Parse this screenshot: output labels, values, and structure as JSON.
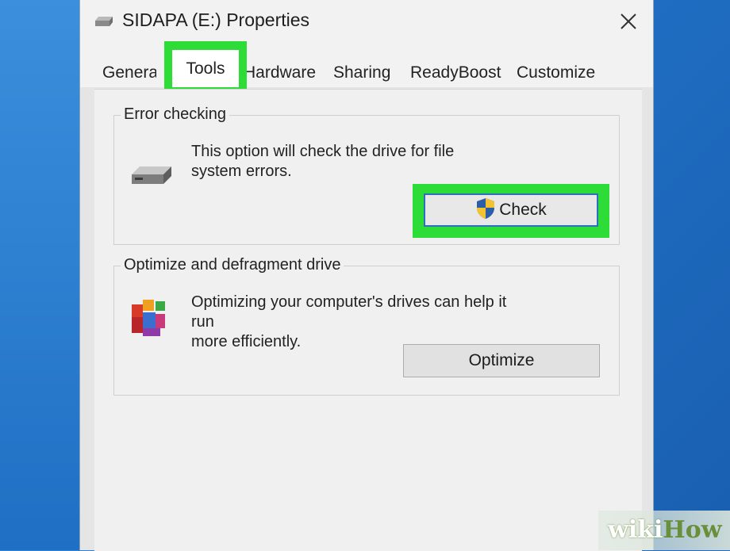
{
  "window": {
    "title": "SIDAPA (E:) Properties",
    "close_icon": "close-icon",
    "drive_icon": "drive-icon"
  },
  "tabs": [
    {
      "label": "General",
      "active": false
    },
    {
      "label": "Tools",
      "active": true
    },
    {
      "label": "Hardware",
      "active": false
    },
    {
      "label": "Sharing",
      "active": false
    },
    {
      "label": "ReadyBoost",
      "active": false
    },
    {
      "label": "Customize",
      "active": false
    }
  ],
  "error_checking": {
    "title": "Error checking",
    "description_line1": "This option will check the drive for file",
    "description_line2": "system errors.",
    "button_label": "Check",
    "button_icon": "uac-shield-icon"
  },
  "optimize": {
    "title": "Optimize and defragment drive",
    "description_line1": "Optimizing your computer's drives can help it run",
    "description_line2": "more efficiently.",
    "button_label": "Optimize",
    "icon": "defragment-icon"
  },
  "colors": {
    "highlight": "#2ddc36",
    "accent_border": "#2d6fbf",
    "desktop": "#1f6fc4"
  },
  "watermark": {
    "part1": "wiki",
    "part2": "How"
  }
}
